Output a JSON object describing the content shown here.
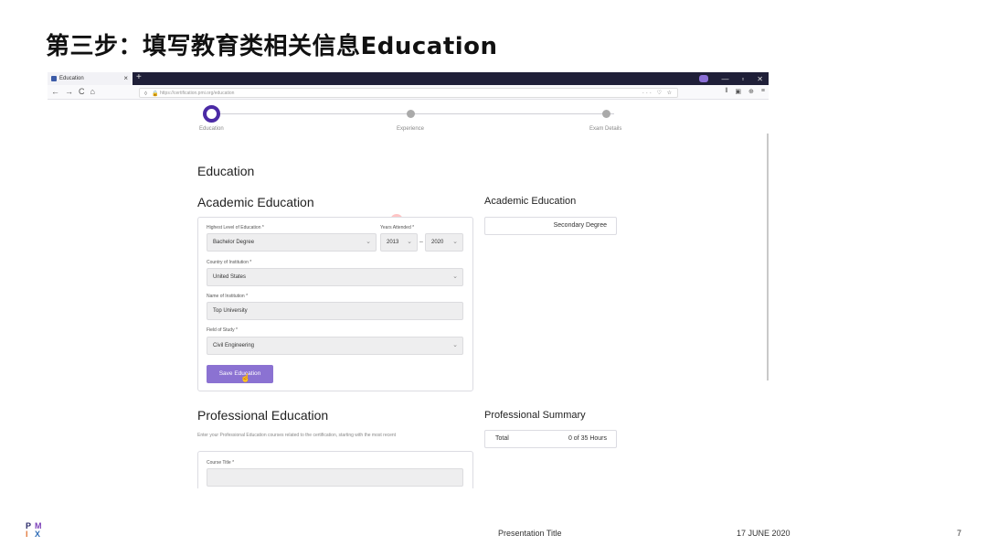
{
  "slide": {
    "title": "第三步：填写教育类相关信息Education",
    "footer_title": "Presentation Title",
    "footer_date": "17 JUNE 2020",
    "footer_page": "7"
  },
  "browser": {
    "tab_title": "Education",
    "tab_close": "×",
    "new_tab": "+",
    "url": "https://certification.pmi.org/education",
    "window_controls": [
      "—",
      "▫",
      "✕"
    ],
    "nav": {
      "back": "←",
      "forward": "→",
      "reload": "C",
      "home": "⌂"
    },
    "url_actions": "··· ♡ ☆",
    "tools": [
      "⫴",
      "▣",
      "⊕",
      "≡"
    ]
  },
  "stepper": {
    "steps": [
      {
        "label": "Education",
        "active": true
      },
      {
        "label": "Experience",
        "active": false
      },
      {
        "label": "Exam Details",
        "active": false
      }
    ]
  },
  "education": {
    "page_heading": "Education",
    "academic_heading": "Academic Education",
    "form": {
      "highest_level_label": "Highest Level of Education *",
      "highest_level_value": "Bachelor Degree",
      "years_label": "Years Attended *",
      "year_from": "2013",
      "year_to": "2020",
      "year_separator": "–",
      "country_label": "Country of Institution *",
      "country_value": "United States",
      "institution_label": "Name of Institution *",
      "institution_value": "Top University",
      "field_label": "Field of Study *",
      "field_value": "Civil Engineering",
      "save_button": "Save Education"
    },
    "academic_summary_heading": "Academic Education",
    "academic_summary_value": "Secondary Degree",
    "professional_heading": "Professional Education",
    "professional_description": "Enter your Professional Education courses related to the certification, starting with the most recent",
    "course_title_label": "Course Title *",
    "professional_summary_heading": "Professional Summary",
    "summary_total_label": "Total",
    "summary_total_value": "0 of 35 Hours"
  },
  "icons": {
    "chevron": "⌄",
    "cursor": "☝",
    "shield": "◊",
    "lock": "🔒"
  },
  "colors": {
    "accent": "#4b2aa5",
    "button": "#8b72d2",
    "tabbar": "#1f1f38"
  }
}
